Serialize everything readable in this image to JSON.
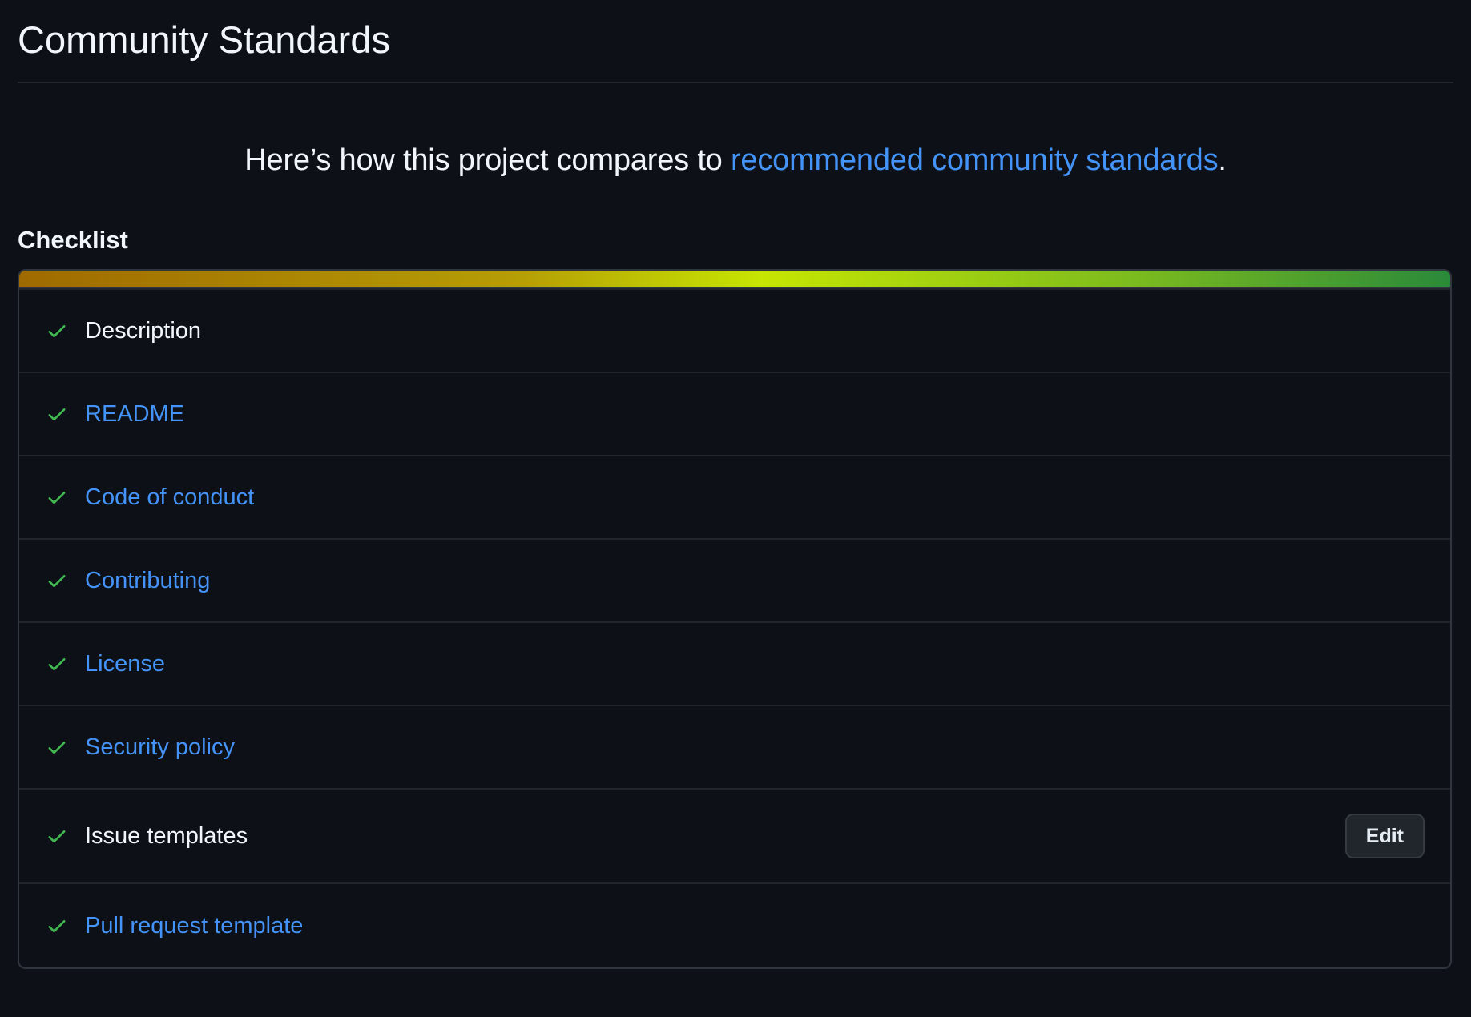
{
  "page": {
    "title": "Community Standards"
  },
  "intro": {
    "prefix": "Here’s how this project compares to ",
    "link_text": "recommended community standards",
    "suffix": "."
  },
  "checklist": {
    "heading": "Checklist",
    "progress": 1.0,
    "items": [
      {
        "label": "Description",
        "link": false,
        "done": true
      },
      {
        "label": "README",
        "link": true,
        "done": true
      },
      {
        "label": "Code of conduct",
        "link": true,
        "done": true
      },
      {
        "label": "Contributing",
        "link": true,
        "done": true
      },
      {
        "label": "License",
        "link": true,
        "done": true
      },
      {
        "label": "Security policy",
        "link": true,
        "done": true
      },
      {
        "label": "Issue templates",
        "link": false,
        "done": true,
        "action": "Edit"
      },
      {
        "label": "Pull request template",
        "link": true,
        "done": true
      }
    ]
  },
  "colors": {
    "background": "#0d1117",
    "link": "#4493f8",
    "check": "#3fb950",
    "border": "#30363d"
  },
  "icons": {
    "check": "check-icon"
  }
}
